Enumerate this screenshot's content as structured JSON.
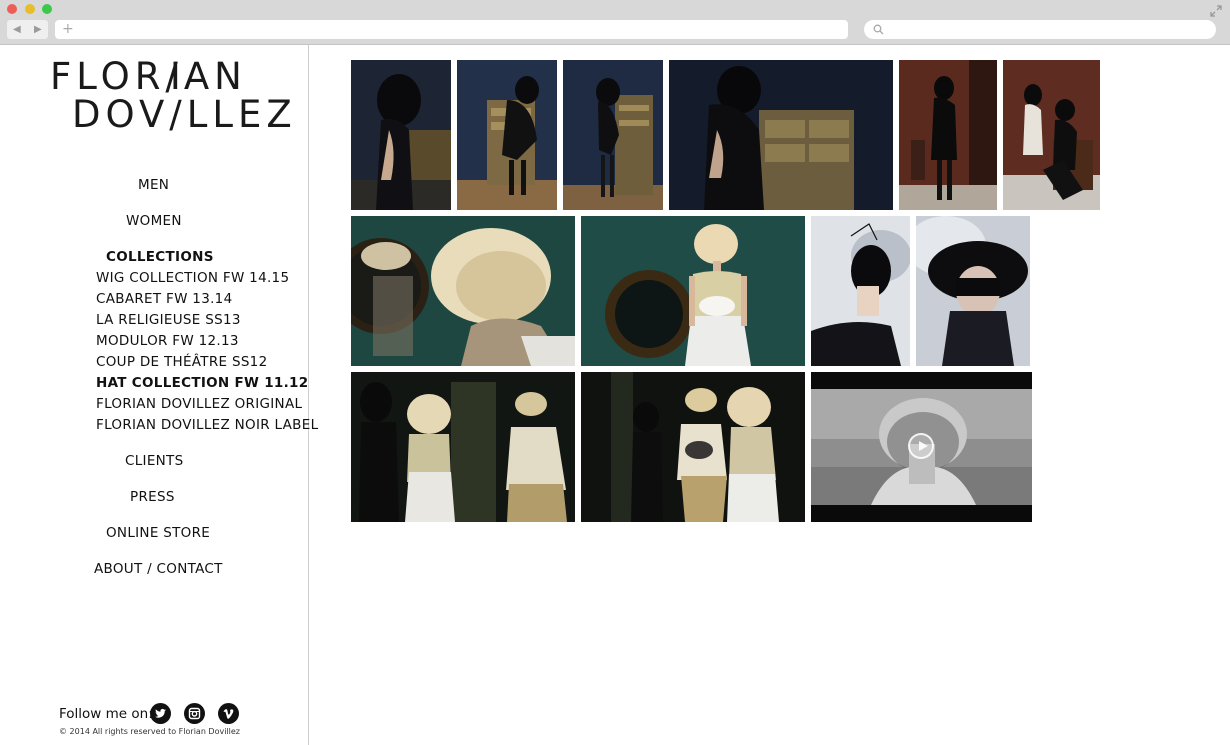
{
  "brand": {
    "line1_a": "FLOR",
    "line1_b": "I",
    "line1_c": "AN",
    "line2_a": "DOV",
    "line2_b": "/",
    "line2_c": "LLEZ"
  },
  "nav": {
    "men": "MEN",
    "women": "WOMEN",
    "collections": "COLLECTIONS",
    "collection_items": [
      "WIG COLLECTION FW 14.15",
      "CABARET FW 13.14",
      "LA RELIGIEUSE SS13",
      "MODULOR FW 12.13",
      "COUP DE THÉÂTRE SS12",
      "HAT COLLECTION FW 11.12",
      "FLORIAN DOVILLEZ ORIGINAL",
      "FLORIAN DOVILLEZ NOIR LABEL"
    ],
    "active_collection": "HAT COLLECTION FW 11.12",
    "clients": "CLIENTS",
    "press": "PRESS",
    "online_store": "ONLINE STORE",
    "about_contact": "ABOUT / CONTACT"
  },
  "footer": {
    "follow_label": "Follow me on:",
    "social_icons": [
      "twitter-icon",
      "instagram-icon",
      "vimeo-icon"
    ],
    "copyright": "© 2014 All rights reserved to Florian Dovillez"
  },
  "gallery": {
    "rows": 3,
    "tiles": [
      {
        "id": "photo-1",
        "tone": "dark-navy"
      },
      {
        "id": "photo-2",
        "tone": "navy-cabinet"
      },
      {
        "id": "photo-3",
        "tone": "navy-standing"
      },
      {
        "id": "photo-4",
        "tone": "navy-wide"
      },
      {
        "id": "photo-5",
        "tone": "brick-red"
      },
      {
        "id": "photo-6",
        "tone": "brick-seated"
      },
      {
        "id": "photo-7",
        "tone": "teal-blonde"
      },
      {
        "id": "photo-8",
        "tone": "teal-mirror"
      },
      {
        "id": "photo-9",
        "tone": "grey-fascinator"
      },
      {
        "id": "photo-10",
        "tone": "grey-hat"
      },
      {
        "id": "photo-11",
        "tone": "dark-group"
      },
      {
        "id": "photo-12",
        "tone": "dark-group-2"
      },
      {
        "id": "video-1",
        "tone": "bw-video",
        "is_video": true
      }
    ]
  },
  "colors": {
    "navy": "#1e2636",
    "brick": "#5a2a20",
    "teal": "#1f4a43",
    "grey": "#c8ccd2",
    "blonde": "#e6d7b4",
    "dark": "#141414"
  }
}
